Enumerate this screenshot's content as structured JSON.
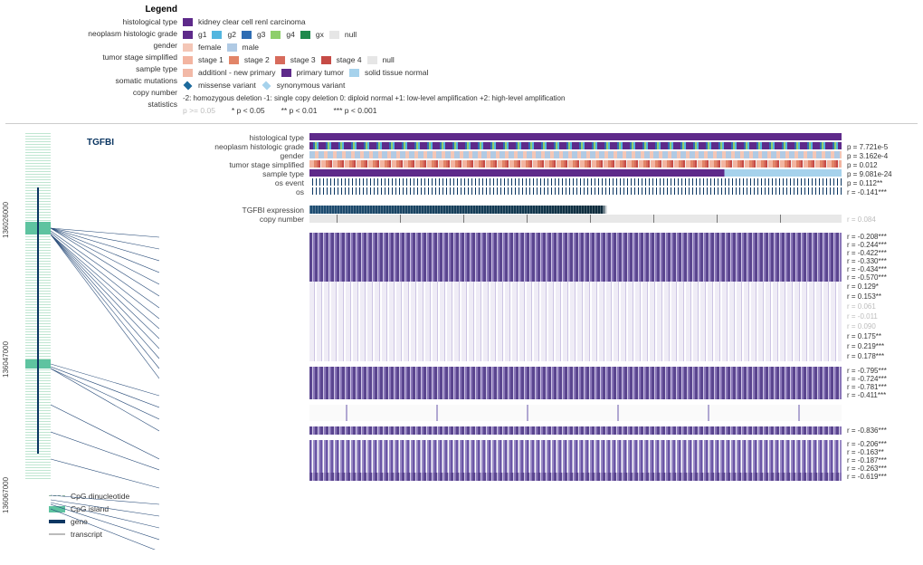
{
  "legend": {
    "title": "Legend",
    "rows": {
      "histological_type": {
        "label": "histological type",
        "items": [
          {
            "color": "#5e2a8a",
            "text": "kidney clear cell renl carcinoma"
          }
        ]
      },
      "neoplasm_grade": {
        "label": "neoplasm histologic grade",
        "items": [
          {
            "color": "#5e2a8a",
            "text": "g1"
          },
          {
            "color": "#53b6df",
            "text": "g2"
          },
          {
            "color": "#2f6db3",
            "text": "g3"
          },
          {
            "color": "#8fcf6b",
            "text": "g4"
          },
          {
            "color": "#1f8a4c",
            "text": "gx"
          },
          {
            "color": "#e6e6e6",
            "text": "null"
          }
        ]
      },
      "gender": {
        "label": "gender",
        "items": [
          {
            "color": "#f4c6b6",
            "text": "female"
          },
          {
            "color": "#b0cae4",
            "text": "male"
          }
        ]
      },
      "tumor_stage": {
        "label": "tumor stage simplified",
        "items": [
          {
            "color": "#f3b5a1",
            "text": "stage 1"
          },
          {
            "color": "#e28568",
            "text": "stage 2"
          },
          {
            "color": "#d76b5c",
            "text": "stage 3"
          },
          {
            "color": "#c64b46",
            "text": "stage 4"
          },
          {
            "color": "#e6e6e6",
            "text": "null"
          }
        ]
      },
      "sample_type": {
        "label": "sample type",
        "items": [
          {
            "color": "#f2b9a7",
            "text": "additionl - new primary"
          },
          {
            "color": "#5e2a8a",
            "text": "primary tumor"
          },
          {
            "color": "#a6d2ec",
            "text": "solid tissue normal"
          }
        ]
      },
      "somatic_mutations": {
        "label": "somatic mutations",
        "items": [
          {
            "color": "#1c6a9c",
            "shape": "diamond",
            "text": "missense variant"
          },
          {
            "color": "#a6d2ec",
            "shape": "diamond",
            "text": "synonymous variant"
          }
        ]
      },
      "copy_number": {
        "label": "copy number",
        "text": "-2: homozygous deletion  -1: single copy deletion  0: diploid normal  +1: low-level amplification  +2: high-level amplification",
        "glyphs": "▁ ▂ ─ ▄ ▅"
      },
      "statistics": {
        "label": "statistics",
        "items": [
          {
            "class": "sig-gray",
            "text": "p >= 0.05"
          },
          {
            "text": "* p < 0.05"
          },
          {
            "text": "** p < 0.01"
          },
          {
            "text": "*** p < 0.001"
          }
        ]
      }
    }
  },
  "axis_ticks": [
    "136026000",
    "136047000",
    "136067000"
  ],
  "gene_label": "TGFBI",
  "clinical_rows": [
    {
      "label": "histological type",
      "class": "h-purple",
      "stat": ""
    },
    {
      "label": "neoplasm histologic grade",
      "class": "h-hist",
      "stat": "p = 7.721e-5"
    },
    {
      "label": "gender",
      "class": "h-gender",
      "stat": "p = 3.162e-4"
    },
    {
      "label": "tumor stage simplified",
      "class": "h-stage",
      "stat": "p = 0.012"
    },
    {
      "label": "sample type",
      "class": "h-sample",
      "stat": "p = 9.081e-24"
    },
    {
      "label": "os event",
      "class": "h-os",
      "stat": "p = 0.112**"
    },
    {
      "label": "os",
      "class": "h-os",
      "stat": "r = -0.141***"
    }
  ],
  "expression_rows": [
    {
      "label": "TGFBI expression",
      "class": "h-expr",
      "stat": ""
    },
    {
      "label": "copy number",
      "class": "h-copy",
      "stat": "r = 0.084",
      "gray": true
    }
  ],
  "meth_rows": [
    {
      "class": "h-meth dense",
      "stat": "r = -0.208***"
    },
    {
      "class": "h-meth dense",
      "stat": "r = -0.244***"
    },
    {
      "class": "h-meth dense",
      "stat": "r = -0.422***"
    },
    {
      "class": "h-meth dense",
      "stat": "r = -0.330***"
    },
    {
      "class": "h-meth dense",
      "stat": "r = -0.434***"
    },
    {
      "class": "h-meth dense",
      "stat": "r = -0.570***"
    },
    {
      "class": "h-meth lowr",
      "stat": "r = 0.129*"
    },
    {
      "class": "h-meth lowr",
      "stat": "r = 0.153**"
    },
    {
      "class": "h-meth lowr",
      "stat": "r = 0.061",
      "gray": true
    },
    {
      "class": "h-meth lowr",
      "stat": "r = -0.011",
      "gray": true
    },
    {
      "class": "h-meth lowr",
      "stat": "r = 0.090",
      "gray": true
    },
    {
      "class": "h-meth lowr",
      "stat": "r = 0.175**"
    },
    {
      "class": "h-meth lowr",
      "stat": "r = 0.219***"
    },
    {
      "class": "h-meth lowr",
      "stat": "r = 0.178***"
    },
    {
      "gap": true
    },
    {
      "class": "h-meth dense",
      "stat": "r = -0.795***"
    },
    {
      "class": "h-meth dense",
      "stat": "r = -0.724***"
    },
    {
      "class": "h-meth dense",
      "stat": "r = -0.781***"
    },
    {
      "class": "h-meth dense",
      "stat": "r = -0.411***"
    },
    {
      "gap": true
    },
    {
      "class": "h-sparse",
      "stat": ""
    },
    {
      "class": "h-sparse",
      "stat": ""
    },
    {
      "gap": true
    },
    {
      "class": "h-meth dense",
      "stat": "r = -0.836***"
    },
    {
      "gap": true
    },
    {
      "class": "h-meth",
      "stat": "r = -0.206***"
    },
    {
      "class": "h-meth",
      "stat": "r = -0.163**"
    },
    {
      "class": "h-meth",
      "stat": "r = -0.187***"
    },
    {
      "class": "h-meth",
      "stat": "r = -0.263***"
    },
    {
      "class": "h-meth dense",
      "stat": "r = -0.619***"
    }
  ],
  "bottom_legend": [
    {
      "style": "border-top:1px dashed #8fb59f;",
      "text": "CpG dinucleotide"
    },
    {
      "style": "background:#5ec3a0;height:7px;",
      "text": "CpG island"
    },
    {
      "style": "background:#0b3662;height:4px;",
      "text": "gene"
    },
    {
      "style": "background:#bbb;height:2px;",
      "text": "transcript"
    }
  ],
  "chart_data": {
    "type": "heatmap",
    "title": "MethSurv-style multi-omic heatmap for gene TGFBI",
    "gene": "TGFBI",
    "genomic_axis": {
      "ticks": [
        136026000,
        136047000,
        136067000
      ]
    },
    "clinical_tracks": [
      {
        "name": "histological type",
        "statistic": null
      },
      {
        "name": "neoplasm histologic grade",
        "statistic": {
          "p": 7.721e-05
        }
      },
      {
        "name": "gender",
        "statistic": {
          "p": 0.0003162
        }
      },
      {
        "name": "tumor stage simplified",
        "statistic": {
          "p": 0.012
        }
      },
      {
        "name": "sample type",
        "statistic": {
          "p": 9.081e-24
        }
      },
      {
        "name": "os event",
        "statistic": {
          "p_label": "0.112**"
        }
      },
      {
        "name": "os",
        "statistic": {
          "r": -0.141,
          "sig": "***"
        }
      }
    ],
    "expression_tracks": [
      {
        "name": "TGFBI expression"
      },
      {
        "name": "copy number",
        "statistic": {
          "r": 0.084,
          "sig": "ns"
        }
      }
    ],
    "methylation_probes": [
      {
        "r": -0.208,
        "sig": "***"
      },
      {
        "r": -0.244,
        "sig": "***"
      },
      {
        "r": -0.422,
        "sig": "***"
      },
      {
        "r": -0.33,
        "sig": "***"
      },
      {
        "r": -0.434,
        "sig": "***"
      },
      {
        "r": -0.57,
        "sig": "***"
      },
      {
        "r": 0.129,
        "sig": "*"
      },
      {
        "r": 0.153,
        "sig": "**"
      },
      {
        "r": 0.061,
        "sig": "ns"
      },
      {
        "r": -0.011,
        "sig": "ns"
      },
      {
        "r": 0.09,
        "sig": "ns"
      },
      {
        "r": 0.175,
        "sig": "**"
      },
      {
        "r": 0.219,
        "sig": "***"
      },
      {
        "r": 0.178,
        "sig": "***"
      },
      {
        "r": -0.795,
        "sig": "***"
      },
      {
        "r": -0.724,
        "sig": "***"
      },
      {
        "r": -0.781,
        "sig": "***"
      },
      {
        "r": -0.411,
        "sig": "***"
      },
      {
        "r": -0.836,
        "sig": "***"
      },
      {
        "r": -0.206,
        "sig": "***"
      },
      {
        "r": -0.163,
        "sig": "**"
      },
      {
        "r": -0.187,
        "sig": "***"
      },
      {
        "r": -0.263,
        "sig": "***"
      },
      {
        "r": -0.619,
        "sig": "***"
      }
    ],
    "statistics_legend": {
      "ns": "p >= 0.05",
      "*": "p < 0.05",
      "**": "p < 0.01",
      "***": "p < 0.001"
    }
  }
}
